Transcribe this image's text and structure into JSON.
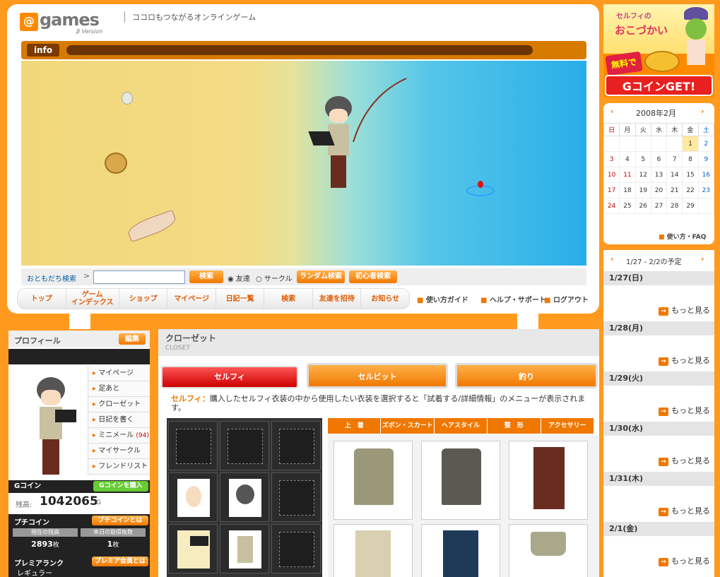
{
  "header": {
    "logo_at": "@",
    "logo_text": "games",
    "logo_beta": "β Version",
    "tagline": "ココロもつながるオンラインゲーム",
    "info_label": "info"
  },
  "search": {
    "label": "おともだち検索",
    "input_value": "",
    "search_btn": "検索",
    "radio_friend": "友達",
    "radio_circle": "サークル",
    "random_btn": "ランダム検索",
    "beginner_btn": "初心者検索"
  },
  "nav": {
    "items": [
      "トップ",
      "ゲーム\nインデックス",
      "ショップ",
      "マイページ",
      "日記一覧",
      "検索",
      "友達を招待",
      "お知らせ"
    ],
    "guide": "使い方ガイド",
    "help": "ヘルプ・サポート",
    "logout": "ログアウト"
  },
  "profile": {
    "title": "プロフィール",
    "edit": "編集",
    "menu": [
      "マイページ",
      "足あと",
      "クローゼット",
      "日記を書く",
      "ミニメール",
      "マイサークル",
      "フレンドリスト"
    ],
    "mail_count": "(94)",
    "gcoin_label": "Gコイン",
    "gcoin_buy": "Gコインを購入",
    "balance_label": "残高:",
    "balance": "1042065",
    "balance_unit": "G",
    "puchi_label": "プチコイン",
    "puchi_about": "プチコインとは",
    "puchi_current_label": "現在の残高",
    "puchi_today_label": "本日の取得枚数",
    "puchi_current": "2893",
    "puchi_today": "1",
    "puchi_unit": "枚",
    "premium_label": "プレミアランク",
    "premium_about": "プレミア会員とは",
    "premium_rank": "レギュラー"
  },
  "closet": {
    "title": "クローゼット",
    "subtitle": "CLOSET",
    "tabs": [
      "セルフィ",
      "セルビット",
      "釣り"
    ],
    "desc_label": "セルフィ：",
    "desc": "購入したセルフィ衣装の中から使用したい衣装を選択すると「試着する/詳細情報」のメニューが表示されます。",
    "categories": [
      "上　着",
      "ズボン・スカート",
      "ヘアスタイル",
      "整　形",
      "アクセサリー"
    ]
  },
  "banner": {
    "line1": "セルフィの",
    "line2": "おこづかい",
    "free": "無料で",
    "cta": "GコインGET!"
  },
  "calendar": {
    "month": "2008年2月",
    "weekdays": [
      "日",
      "月",
      "火",
      "水",
      "木",
      "金",
      "土"
    ],
    "weeks": [
      [
        "",
        "",
        "",
        "",
        "",
        "1",
        "2"
      ],
      [
        "3",
        "4",
        "5",
        "6",
        "7",
        "8",
        "9"
      ],
      [
        "10",
        "11",
        "12",
        "13",
        "14",
        "15",
        "16"
      ],
      [
        "17",
        "18",
        "19",
        "20",
        "21",
        "22",
        "23"
      ],
      [
        "24",
        "25",
        "26",
        "27",
        "28",
        "29",
        ""
      ]
    ],
    "faq": "使い方・FAQ"
  },
  "schedule": {
    "range": "1/27 - 2/2の予定",
    "more": "もっと見る",
    "days": [
      "1/27(日)",
      "1/28(月)",
      "1/29(火)",
      "1/30(水)",
      "1/31(木)",
      "2/1(金)"
    ]
  }
}
